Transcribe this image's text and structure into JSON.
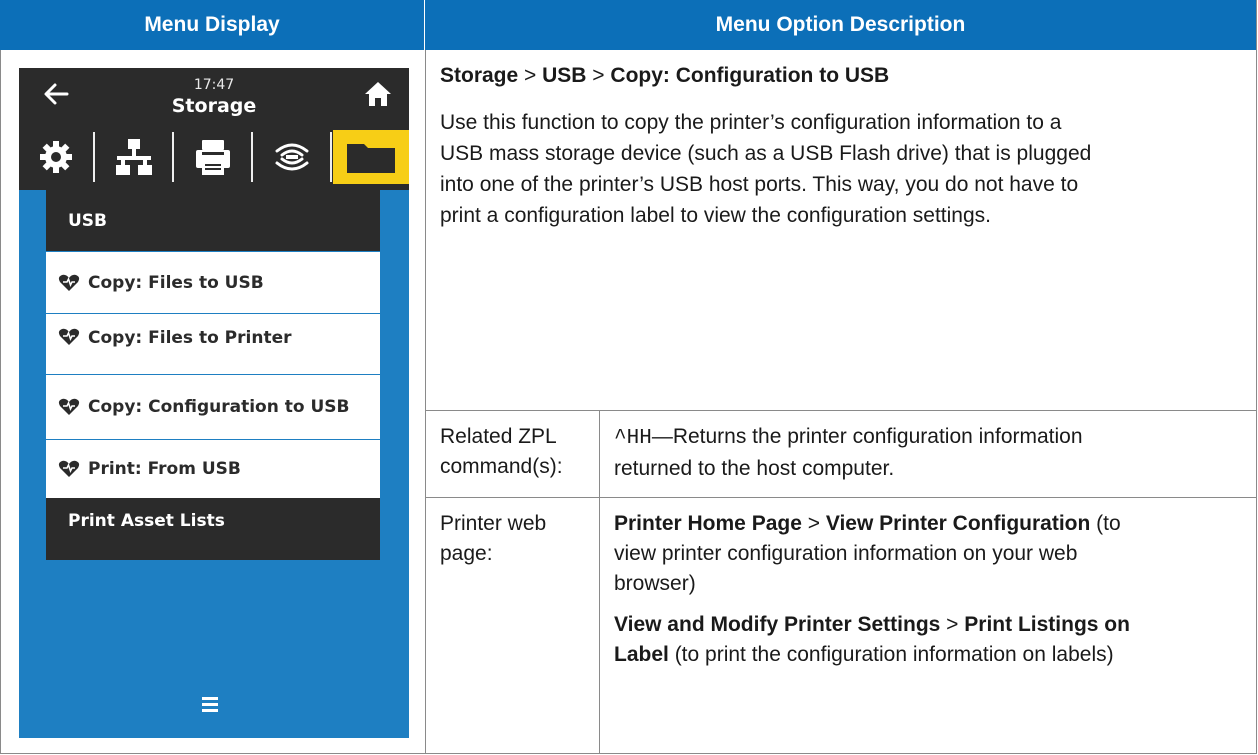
{
  "headers": {
    "left": "Menu Display",
    "right": "Menu Option Description"
  },
  "device": {
    "time": "17:47",
    "title": "Storage",
    "tab_icons": [
      "settings-gear-icon",
      "network-icon",
      "printer-icon",
      "rfid-wireless-icon",
      "folder-icon"
    ],
    "menu_items": [
      {
        "label": "USB",
        "style": "dark",
        "heart": false
      },
      {
        "label": "Copy: Files to USB",
        "style": "light",
        "heart": true
      },
      {
        "label": "Copy: Files to Printer",
        "style": "light",
        "heart": true
      },
      {
        "label": "Copy: Configuration to USB",
        "style": "light",
        "heart": true
      },
      {
        "label": "Print: From USB",
        "style": "light",
        "heart": true
      },
      {
        "label": "Print Asset Lists",
        "style": "dark",
        "heart": false
      }
    ],
    "colors": {
      "screen_bg": "#1e7fc2",
      "bar_bg": "#2b2b2b",
      "active_tab": "#f7ce16",
      "header_bg": "#0c6fb8"
    }
  },
  "description": {
    "path": [
      "Storage",
      " > ",
      "USB",
      " > ",
      "Copy: Configuration to USB"
    ],
    "body_lines": [
      "Use this function to copy the printer’s configuration information to a",
      "USB mass storage device (such as a USB Flash drive) that is plugged",
      "into one of the printer’s USB host ports. This way, you do not have to",
      "print a configuration label to view the configuration settings."
    ],
    "zpl_label": [
      "Related ZPL",
      "command(s):"
    ],
    "zpl_code": "^HH",
    "zpl_text_1": "—Returns the printer configuration information",
    "zpl_text_2": "returned to the host computer.",
    "web_label": [
      "Printer web",
      "page:"
    ],
    "web_1_bold_a": "Printer Home Page",
    "web_1_sep": " > ",
    "web_1_bold_b": "View Printer Configuration",
    "web_1_tail": " (to",
    "web_1_line2": "view printer configuration information on your web",
    "web_1_line3": "browser)",
    "web_2_bold_a": "View and Modify Printer Settings",
    "web_2_sep": " > ",
    "web_2_bold_b": "Print Listings on",
    "web_2_bold_c": "Label",
    "web_2_tail": " (to print the configuration information on labels)"
  }
}
